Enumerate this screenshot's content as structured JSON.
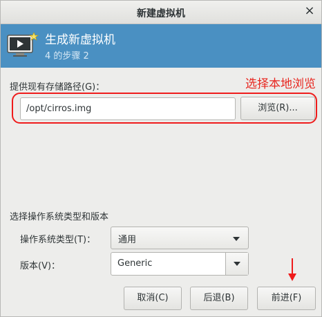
{
  "window": {
    "title": "新建虚拟机",
    "close_glyph": "×"
  },
  "banner": {
    "title": "生成新虚拟机",
    "step": "4 的步骤 2",
    "icon": "monitor-play-icon",
    "color": "#4a90c2"
  },
  "storage": {
    "label": "提供现有存储路径(G)：",
    "path_value": "/opt/cirros.img",
    "browse_label": "浏览(R)...",
    "annotation": "选择本地浏览",
    "annotation_color": "#e8261f"
  },
  "os": {
    "section_label": "选择操作系统类型和版本",
    "type_label": "操作系统类型(T)：",
    "type_value": "通用",
    "version_label": "版本(V)：",
    "version_value": "Generic"
  },
  "buttons": {
    "cancel": "取消(C)",
    "back": "后退(B)",
    "forward": "前进(F)"
  }
}
